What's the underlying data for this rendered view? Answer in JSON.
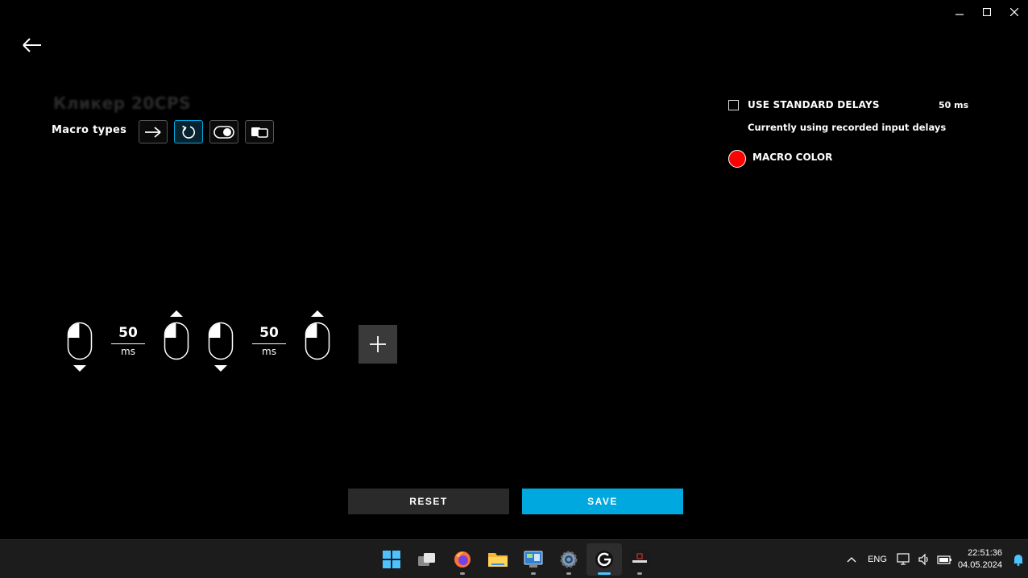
{
  "macro": {
    "name": "Кликер 20CPS",
    "types_label": "Macro types"
  },
  "options": {
    "standard_delays_label": "USE STANDARD DELAYS",
    "standard_delays_value": "50 ms",
    "delays_note": "Currently using recorded input delays",
    "macro_color_label": "MACRO COLOR",
    "macro_color": "#ff0000"
  },
  "steps": [
    {
      "type": "left-click",
      "direction": "down"
    },
    {
      "type": "delay",
      "value": "50",
      "unit": "ms"
    },
    {
      "type": "left-click",
      "direction": "up"
    },
    {
      "type": "left-click",
      "direction": "down"
    },
    {
      "type": "delay",
      "value": "50",
      "unit": "ms"
    },
    {
      "type": "left-click",
      "direction": "up"
    }
  ],
  "buttons": {
    "reset": "RESET",
    "save": "SAVE"
  },
  "colors": {
    "accent": "#00a8e0",
    "background": "#000000"
  },
  "taskbar": {
    "apps": [
      "windows-start",
      "task-view",
      "firefox",
      "file-explorer",
      "control-panel",
      "settings",
      "logitech-g-hub",
      "realtek-audio"
    ],
    "language": "ENG",
    "time": "22:51:36",
    "date": "04.05.2024"
  }
}
